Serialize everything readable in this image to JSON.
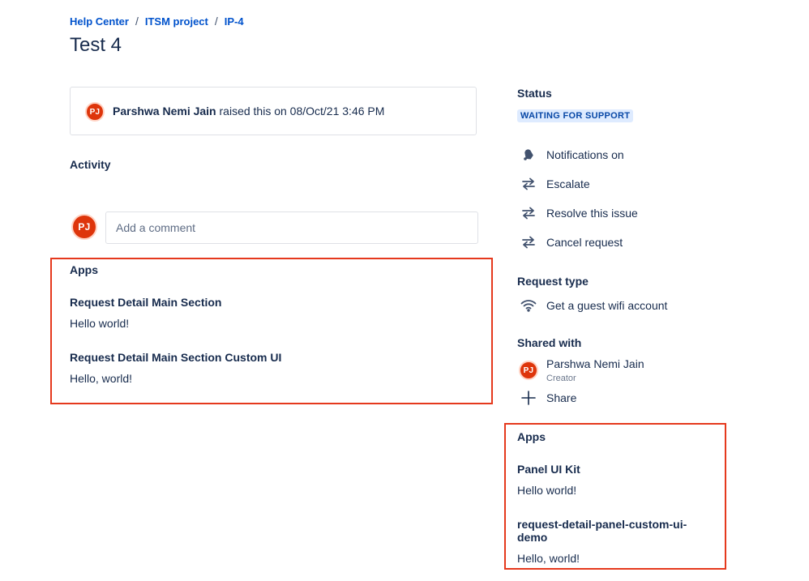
{
  "breadcrumb": {
    "items": [
      "Help Center",
      "ITSM project",
      "IP-4"
    ],
    "separator": "/"
  },
  "page_title": "Test 4",
  "raised": {
    "initials": "PJ",
    "name": "Parshwa Nemi Jain",
    "text": "raised this on 08/Oct/21 3:46 PM"
  },
  "activity": {
    "heading": "Activity",
    "comment_initials": "PJ",
    "comment_placeholder": "Add a comment"
  },
  "main_apps": {
    "heading": "Apps",
    "sections": [
      {
        "title": "Request Detail Main Section",
        "body": "Hello world!"
      },
      {
        "title": "Request Detail Main Section Custom UI",
        "body": "Hello, world!"
      }
    ]
  },
  "sidebar": {
    "status_heading": "Status",
    "status_value": "WAITING FOR SUPPORT",
    "actions": [
      {
        "icon": "bell-icon",
        "label": "Notifications on"
      },
      {
        "icon": "transition-arrows-icon",
        "label": "Escalate"
      },
      {
        "icon": "transition-arrows-icon",
        "label": "Resolve this issue"
      },
      {
        "icon": "transition-arrows-icon",
        "label": "Cancel request"
      }
    ],
    "request_type_heading": "Request type",
    "request_type_icon": "wifi-icon",
    "request_type_value": "Get a guest wifi account",
    "shared_heading": "Shared with",
    "shared_user": {
      "initials": "PJ",
      "name": "Parshwa Nemi Jain",
      "role": "Creator"
    },
    "share_label": "Share",
    "apps": {
      "heading": "Apps",
      "sections": [
        {
          "title": "Panel UI Kit",
          "body": "Hello world!"
        },
        {
          "title": "request-detail-panel-custom-ui-demo",
          "body": "Hello, world!"
        }
      ]
    }
  },
  "colors": {
    "link": "#0052cc",
    "text": "#172b4d",
    "avatar": "#de350b",
    "highlight_border": "#e5391d",
    "lozenge_bg": "#deebff",
    "lozenge_text": "#0747a6"
  }
}
